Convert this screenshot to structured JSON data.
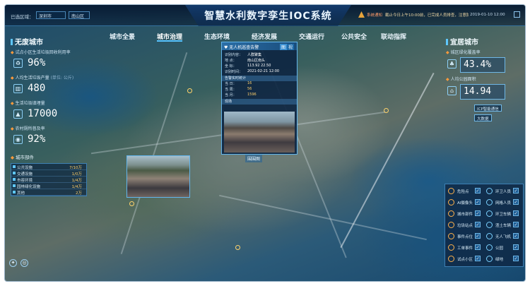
{
  "header": {
    "title": "智慧水利数字孪生IOC系统",
    "location_label": "已选区域：",
    "city_select": "深圳市",
    "district_select": "南山区",
    "alert_label": "系统通知",
    "alert_text": "截止今日上午10:00前，已完成人员排查，注意防范",
    "datetime": "2019-01-10 12:00"
  },
  "nav": [
    "城市全景",
    "城市治理",
    "生态环境",
    "经济发展",
    "交通运行",
    "公共安全",
    "联动指挥"
  ],
  "left": {
    "title": "无废城市",
    "metrics": [
      {
        "label": "试点小区生活垃圾回收利用率",
        "value": "96%",
        "icon": "recycle-icon"
      },
      {
        "label": "人均生活垃圾产量",
        "unit": "(单位: 公斤)",
        "value": "480",
        "icon": "trash-icon"
      },
      {
        "label": "生活垃圾填埋量",
        "value": "17000",
        "icon": "landfill-icon"
      },
      {
        "label": "农村厕所普及率",
        "value": "92%",
        "icon": "toilet-icon"
      }
    ],
    "components_title": "城市部件",
    "components": [
      {
        "label": "公共设施",
        "value": "7/10万"
      },
      {
        "label": "交通设施",
        "value": "1/0万"
      },
      {
        "label": "市容环境",
        "value": "1/4万"
      },
      {
        "label": "园林绿化设施",
        "value": "1/4万"
      },
      {
        "label": "其他",
        "value": "2万"
      }
    ]
  },
  "right": {
    "title": "宜居城市",
    "metric1_label": "城区绿化覆盖率",
    "metric1_value": "43.4%",
    "metric2_label": "人均公园面积",
    "metric2_value": "14.94",
    "button1": "ICP智能通信",
    "button2": "大数据"
  },
  "popup": {
    "title": "无人机巡查告警",
    "btn_a": "图",
    "btn_b": "视",
    "rows": [
      {
        "label": "识别内容：",
        "value": "人群聚集"
      },
      {
        "label": "地    点：",
        "value": "南山区南头"
      },
      {
        "label": "坐    标：",
        "value": "113.92 22.50"
      },
      {
        "label": "识别时间：",
        "value": "2021-02-21 12:00"
      }
    ],
    "section1": "告警实时统计",
    "stats": [
      {
        "label": "当    日：",
        "value": "16"
      },
      {
        "label": "当    周：",
        "value": "56"
      },
      {
        "label": "当    月：",
        "value": "1596"
      }
    ],
    "section2": "现场"
  },
  "map_tags": [
    "围围图"
  ],
  "legend": [
    {
      "label": "危险点",
      "color": "#ffb14a"
    },
    {
      "label": "环卫人员",
      "color": "#7ad1ff"
    },
    {
      "label": "AI摄像头",
      "color": "#ffb14a"
    },
    {
      "label": "网格人员",
      "color": "#7ad1ff"
    },
    {
      "label": "城市部件",
      "color": "#ffb14a"
    },
    {
      "label": "环卫车辆",
      "color": "#7ad1ff"
    },
    {
      "label": "垃圾站点",
      "color": "#ffb14a"
    },
    {
      "label": "渣土车辆",
      "color": "#7ad1ff"
    },
    {
      "label": "事件点位",
      "color": "#ffb14a"
    },
    {
      "label": "无人飞机",
      "color": "#7ad1ff"
    },
    {
      "label": "工单事件",
      "color": "#ffb14a"
    },
    {
      "label": "公园",
      "color": "#7ad1ff"
    },
    {
      "label": "试点小区",
      "color": "#ffb14a"
    },
    {
      "label": "绿地",
      "color": "#7ad1ff"
    }
  ],
  "check_mark": "✓"
}
